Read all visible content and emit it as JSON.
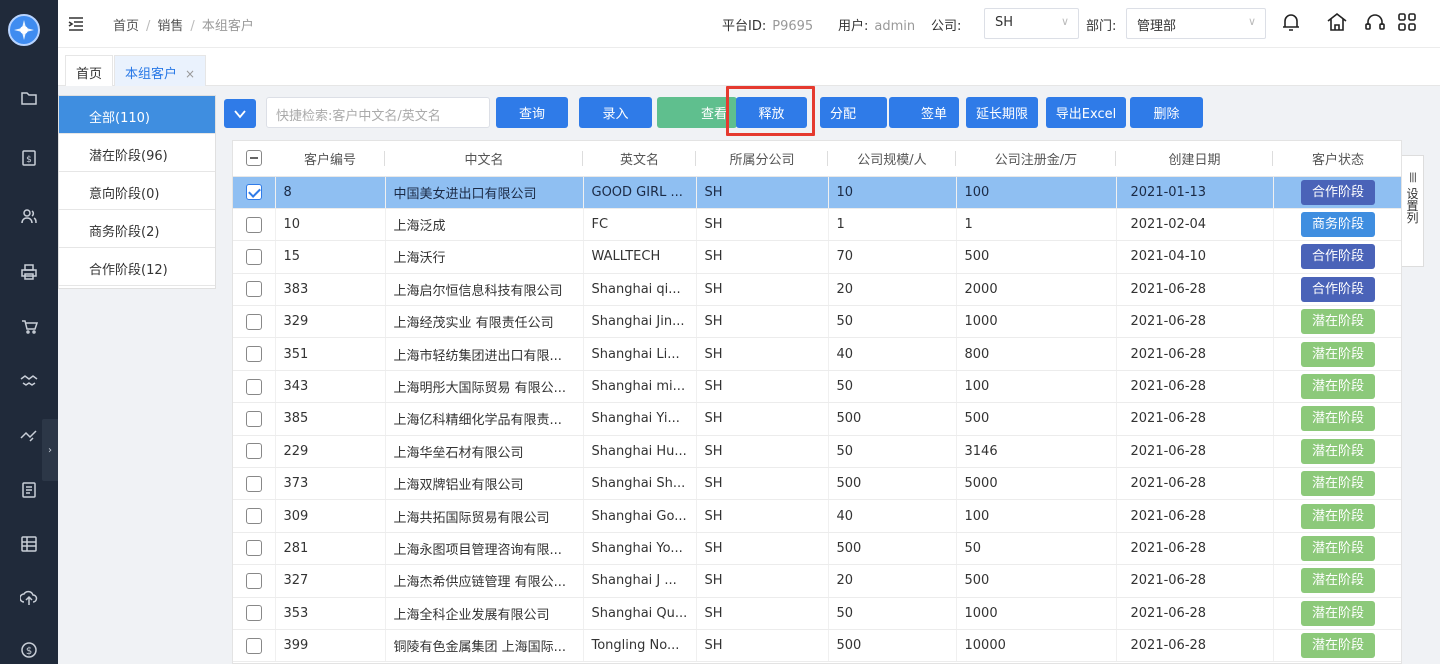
{
  "breadcrumb": [
    "首页",
    "销售",
    "本组客户"
  ],
  "header": {
    "platform_label": "平台ID:",
    "platform_value": "P9695",
    "user_label": "用户:",
    "user_value": "admin",
    "company_label": "公司:",
    "company_value": "SH",
    "dept_label": "部门:",
    "dept_value": "管理部"
  },
  "tabs": [
    {
      "label": "首页"
    },
    {
      "label": "本组客户",
      "close": "×"
    }
  ],
  "stages": [
    "全部(110)",
    "潜在阶段(96)",
    "意向阶段(0)",
    "商务阶段(2)",
    "合作阶段(12)"
  ],
  "toolbar": {
    "search_placeholder": "快捷检索:客户中文名/英文名",
    "buttons": [
      "查询",
      "录入",
      "查看",
      "释放",
      "分配",
      "签单",
      "延长期限",
      "导出Excel",
      "删除"
    ]
  },
  "table": {
    "headers": [
      "客户编号",
      "中文名",
      "英文名",
      "所属分公司",
      "公司规模/人",
      "公司注册金/万",
      "创建日期",
      "客户状态"
    ],
    "rows": [
      {
        "id": "8",
        "cn": "中国美女进出口有限公司",
        "en": "GOOD GIRL ...",
        "branch": "SH",
        "size": "10",
        "capital": "100",
        "date": "2021-01-13",
        "status": "合作阶段",
        "checked": true
      },
      {
        "id": "10",
        "cn": "上海泛成",
        "en": "FC",
        "branch": "SH",
        "size": "1",
        "capital": "1",
        "date": "2021-02-04",
        "status": "商务阶段",
        "checked": false
      },
      {
        "id": "15",
        "cn": "上海沃行",
        "en": "WALLTECH",
        "branch": "SH",
        "size": "70",
        "capital": "500",
        "date": "2021-04-10",
        "status": "合作阶段",
        "checked": false
      },
      {
        "id": "383",
        "cn": "上海启尔恒信息科技有限公司",
        "en": "Shanghai qi...",
        "branch": "SH",
        "size": "20",
        "capital": "2000",
        "date": "2021-06-28",
        "status": "合作阶段",
        "checked": false
      },
      {
        "id": "329",
        "cn": "上海经茂实业 有限责任公司",
        "en": "Shanghai Jin...",
        "branch": "SH",
        "size": "50",
        "capital": "1000",
        "date": "2021-06-28",
        "status": "潜在阶段",
        "checked": false
      },
      {
        "id": "351",
        "cn": "上海市轻纺集团进出口有限...",
        "en": "Shanghai Li...",
        "branch": "SH",
        "size": "40",
        "capital": "800",
        "date": "2021-06-28",
        "status": "潜在阶段",
        "checked": false
      },
      {
        "id": "343",
        "cn": "上海明彤大国际贸易 有限公...",
        "en": "Shanghai mi...",
        "branch": "SH",
        "size": "50",
        "capital": "100",
        "date": "2021-06-28",
        "status": "潜在阶段",
        "checked": false
      },
      {
        "id": "385",
        "cn": "上海亿科精细化学品有限责...",
        "en": "Shanghai Yi...",
        "branch": "SH",
        "size": "500",
        "capital": "500",
        "date": "2021-06-28",
        "status": "潜在阶段",
        "checked": false
      },
      {
        "id": "229",
        "cn": "上海华垒石材有限公司",
        "en": "Shanghai Hu...",
        "branch": "SH",
        "size": "50",
        "capital": "3146",
        "date": "2021-06-28",
        "status": "潜在阶段",
        "checked": false
      },
      {
        "id": "373",
        "cn": "上海双牌铝业有限公司",
        "en": "Shanghai Sh...",
        "branch": "SH",
        "size": "500",
        "capital": "5000",
        "date": "2021-06-28",
        "status": "潜在阶段",
        "checked": false
      },
      {
        "id": "309",
        "cn": "上海共拓国际贸易有限公司",
        "en": "Shanghai Go...",
        "branch": "SH",
        "size": "40",
        "capital": "100",
        "date": "2021-06-28",
        "status": "潜在阶段",
        "checked": false
      },
      {
        "id": "281",
        "cn": "上海永图项目管理咨询有限...",
        "en": "Shanghai Yo...",
        "branch": "SH",
        "size": "500",
        "capital": "50",
        "date": "2021-06-28",
        "status": "潜在阶段",
        "checked": false
      },
      {
        "id": "327",
        "cn": "上海杰希供应链管理 有限公...",
        "en": "Shanghai J ...",
        "branch": "SH",
        "size": "20",
        "capital": "500",
        "date": "2021-06-28",
        "status": "潜在阶段",
        "checked": false
      },
      {
        "id": "353",
        "cn": "上海全科企业发展有限公司",
        "en": "Shanghai Qu...",
        "branch": "SH",
        "size": "50",
        "capital": "1000",
        "date": "2021-06-28",
        "status": "潜在阶段",
        "checked": false
      },
      {
        "id": "399",
        "cn": "铜陵有色金属集团 上海国际...",
        "en": "Tongling No...",
        "branch": "SH",
        "size": "500",
        "capital": "10000",
        "date": "2021-06-28",
        "status": "潜在阶段",
        "checked": false
      }
    ]
  },
  "settings_column_label": "设置列",
  "status_colors": {
    "合作阶段": "#4a63b8",
    "商务阶段": "#3f8ee0",
    "潜在阶段": "#8cc97a"
  },
  "accent_color": "#2f7be8",
  "highlight_color": "#e53a2f",
  "icons": [
    "logo-icon",
    "folder-icon",
    "document-dollar-icon",
    "users-icon",
    "printer-icon",
    "cart-icon",
    "handshake-icon",
    "handshake-alt-icon",
    "invoice-icon",
    "grid-icon",
    "upload-icon",
    "money-icon",
    "menu-fold-icon",
    "bell-icon",
    "home-icon",
    "headset-icon",
    "apps-icon"
  ]
}
